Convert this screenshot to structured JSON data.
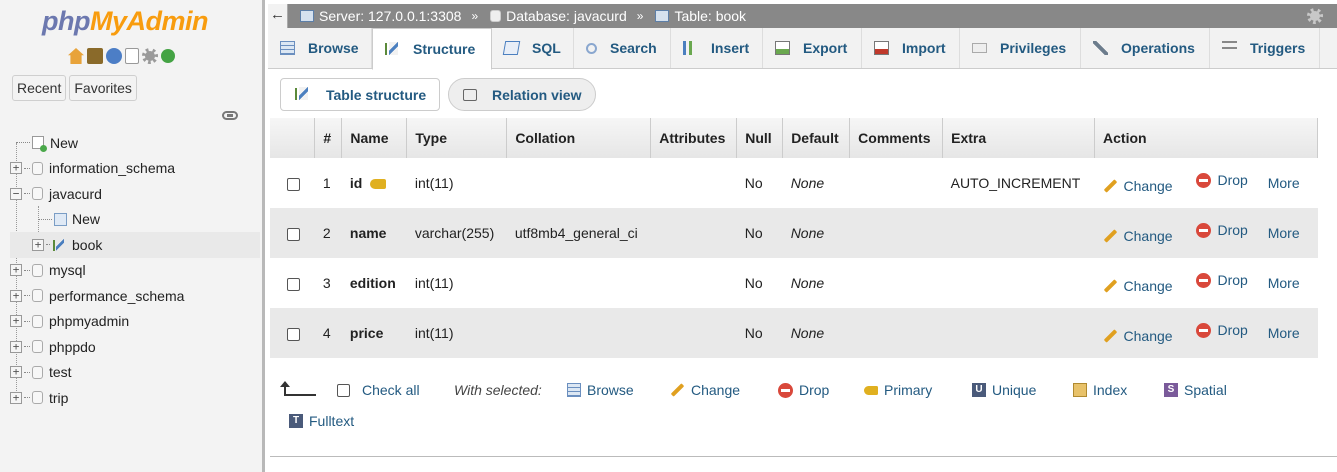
{
  "sidebar": {
    "logo_php": "php",
    "logo_myadmin": "MyAdmin",
    "recent_label": "Recent",
    "favorites_label": "Favorites",
    "tree": [
      {
        "label": "New",
        "type": "new"
      },
      {
        "label": "information_schema",
        "type": "db"
      },
      {
        "label": "javacurd",
        "type": "db"
      },
      {
        "label": "New",
        "type": "new-table"
      },
      {
        "label": "book",
        "type": "table",
        "selected": true
      },
      {
        "label": "mysql",
        "type": "db"
      },
      {
        "label": "performance_schema",
        "type": "db"
      },
      {
        "label": "phpmyadmin",
        "type": "db"
      },
      {
        "label": "phppdo",
        "type": "db"
      },
      {
        "label": "test",
        "type": "db"
      },
      {
        "label": "trip",
        "type": "db"
      }
    ]
  },
  "breadcrumb": {
    "server": "Server: 127.0.0.1:3308",
    "database": "Database: javacurd",
    "table": "Table: book",
    "separator": "»"
  },
  "tabs": [
    {
      "label": "Browse",
      "icon": "browse-icon",
      "active": false
    },
    {
      "label": "Structure",
      "icon": "structure-icon",
      "active": true
    },
    {
      "label": "SQL",
      "icon": "sql-icon",
      "active": false
    },
    {
      "label": "Search",
      "icon": "search-icon",
      "active": false
    },
    {
      "label": "Insert",
      "icon": "insert-icon",
      "active": false
    },
    {
      "label": "Export",
      "icon": "export-icon",
      "active": false
    },
    {
      "label": "Import",
      "icon": "import-icon",
      "active": false
    },
    {
      "label": "Privileges",
      "icon": "privileges-icon",
      "active": false
    },
    {
      "label": "Operations",
      "icon": "operations-icon",
      "active": false
    },
    {
      "label": "Triggers",
      "icon": "triggers-icon",
      "active": false
    }
  ],
  "subtabs": {
    "table_structure": "Table structure",
    "relation_view": "Relation view"
  },
  "table": {
    "headers": [
      "#",
      "Name",
      "Type",
      "Collation",
      "Attributes",
      "Null",
      "Default",
      "Comments",
      "Extra",
      "Action"
    ],
    "rows": [
      {
        "num": "1",
        "name": "id",
        "primary": true,
        "type": "int(11)",
        "collation": "",
        "attributes": "",
        "null": "No",
        "default": "None",
        "comments": "",
        "extra": "AUTO_INCREMENT"
      },
      {
        "num": "2",
        "name": "name",
        "primary": false,
        "type": "varchar(255)",
        "collation": "utf8mb4_general_ci",
        "attributes": "",
        "null": "No",
        "default": "None",
        "comments": "",
        "extra": ""
      },
      {
        "num": "3",
        "name": "edition",
        "primary": false,
        "type": "int(11)",
        "collation": "",
        "attributes": "",
        "null": "No",
        "default": "None",
        "comments": "",
        "extra": ""
      },
      {
        "num": "4",
        "name": "price",
        "primary": false,
        "type": "int(11)",
        "collation": "",
        "attributes": "",
        "null": "No",
        "default": "None",
        "comments": "",
        "extra": ""
      }
    ],
    "actions": {
      "change": "Change",
      "drop": "Drop",
      "more": "More"
    }
  },
  "footer": {
    "check_all": "Check all",
    "with_selected": "With selected:",
    "browse": "Browse",
    "change": "Change",
    "drop": "Drop",
    "primary": "Primary",
    "unique": "Unique",
    "index": "Index",
    "spatial": "Spatial",
    "fulltext": "Fulltext"
  },
  "colors": {
    "link": "#235a81",
    "breadcrumb_bg": "#888888",
    "row_alt": "#e9e9e9",
    "logo_php": "#6c78af",
    "logo_myadmin": "#f89c0e"
  }
}
